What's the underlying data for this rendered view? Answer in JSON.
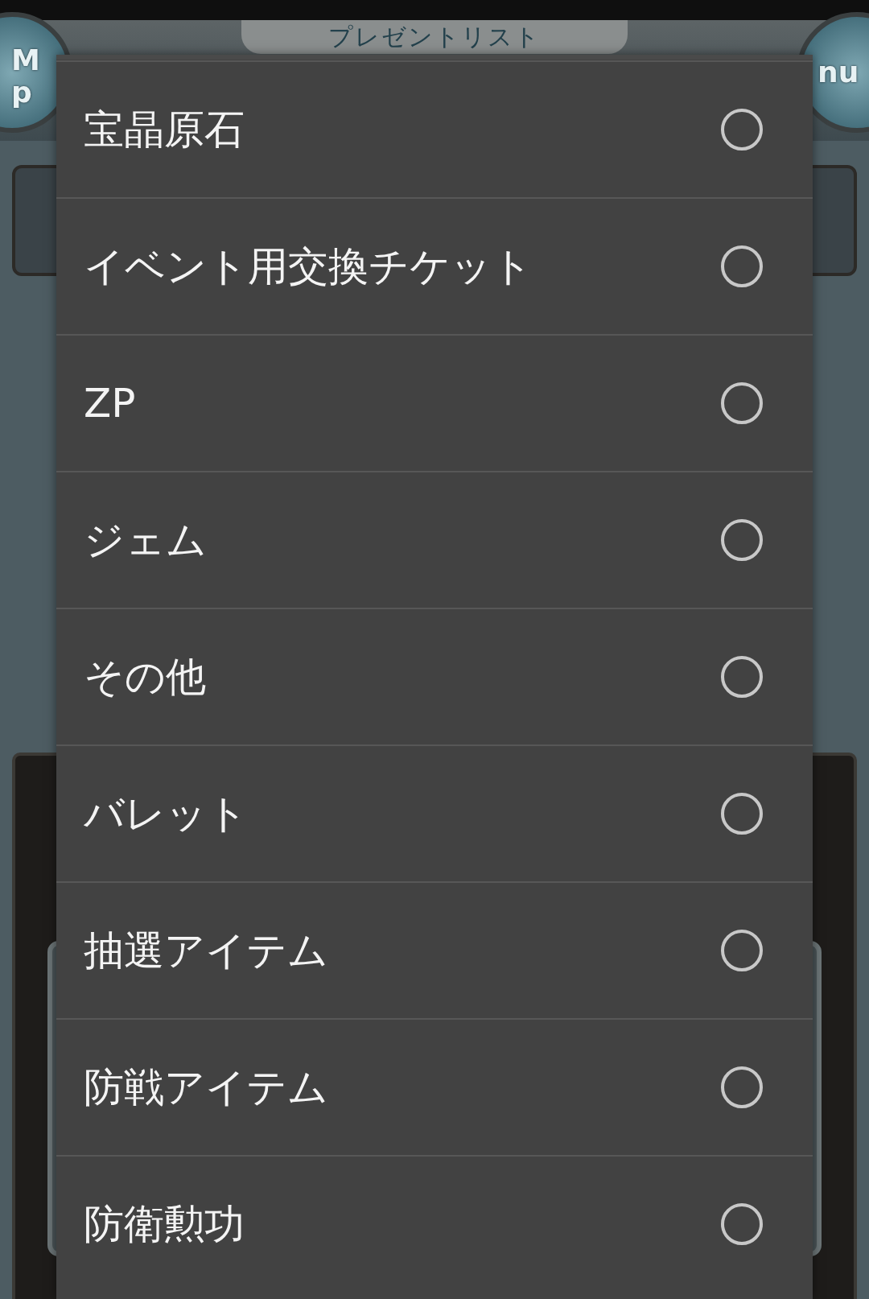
{
  "background": {
    "title": "プレゼントリスト",
    "left_button": [
      "M",
      "p"
    ],
    "right_button": [
      "nu"
    ]
  },
  "dialog": {
    "options": [
      {
        "label": "宝晶原石",
        "selected": false
      },
      {
        "label": "イベント用交換チケット",
        "selected": false
      },
      {
        "label": "ZP",
        "selected": false
      },
      {
        "label": "ジェム",
        "selected": false
      },
      {
        "label": "その他",
        "selected": false
      },
      {
        "label": "バレット",
        "selected": false
      },
      {
        "label": "抽選アイテム",
        "selected": false
      },
      {
        "label": "防戦アイテム",
        "selected": false
      },
      {
        "label": "防衛勲功",
        "selected": false
      }
    ]
  }
}
